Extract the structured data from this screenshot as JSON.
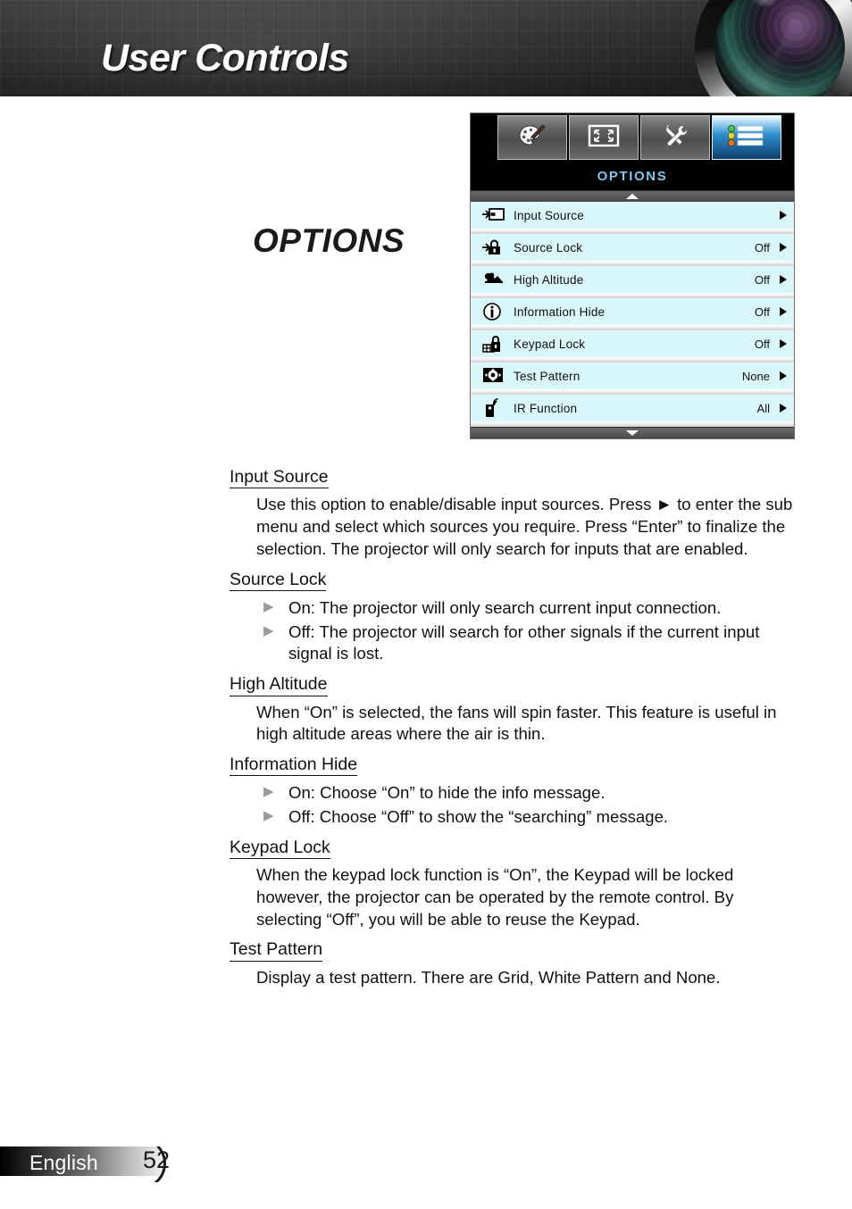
{
  "header": {
    "title": "User Controls",
    "lens_icon": "camera-lens-graphic"
  },
  "section_title": "OPTIONS",
  "osd": {
    "menu_title": "OPTIONS",
    "tabs": [
      {
        "name": "image-tab",
        "icon": "palette-icon",
        "active": false
      },
      {
        "name": "display-tab",
        "icon": "screen-icon",
        "active": false
      },
      {
        "name": "setup-tab",
        "icon": "tools-icon",
        "active": false
      },
      {
        "name": "options-tab",
        "icon": "list-icon",
        "active": true
      }
    ],
    "scroll_up_icon": "triangle-up-icon",
    "scroll_down_icon": "triangle-down-icon",
    "rows": [
      {
        "icon": "input-source-icon",
        "label": "Input Source",
        "value": ""
      },
      {
        "icon": "source-lock-icon",
        "label": "Source Lock",
        "value": "Off"
      },
      {
        "icon": "high-altitude-icon",
        "label": "High Altitude",
        "value": "Off"
      },
      {
        "icon": "information-hide-icon",
        "label": "Information Hide",
        "value": "Off"
      },
      {
        "icon": "keypad-lock-icon",
        "label": "Keypad Lock",
        "value": "Off"
      },
      {
        "icon": "test-pattern-icon",
        "label": "Test Pattern",
        "value": "None"
      },
      {
        "icon": "ir-function-icon",
        "label": "IR Function",
        "value": "All"
      }
    ]
  },
  "sections": [
    {
      "heading": "Input Source",
      "body": "Use this option to enable/disable input sources. Press ► to enter the sub menu and select which sources you require. Press “Enter” to finalize the selection. The projector will only search for inputs that are enabled.",
      "bullets": []
    },
    {
      "heading": "Source Lock",
      "body": "",
      "bullets": [
        "On: The projector will only search current input connection.",
        "Off: The projector will search for other signals if the current input signal is lost."
      ]
    },
    {
      "heading": "High Altitude",
      "body": "When “On” is selected, the fans will spin faster. This feature is useful in high altitude areas where the air is thin.",
      "bullets": []
    },
    {
      "heading": "Information Hide",
      "body": "",
      "bullets": [
        "On: Choose “On” to hide the info message.",
        "Off: Choose “Off” to show the “searching” message."
      ]
    },
    {
      "heading": "Keypad Lock",
      "body": "When the keypad lock function is “On”, the Keypad will be locked however, the projector can be operated by the remote control. By selecting “Off”, you will be able to reuse the Keypad.",
      "bullets": []
    },
    {
      "heading": "Test Pattern",
      "body": "Display a test pattern. There are Grid, White Pattern and None.",
      "bullets": []
    }
  ],
  "footer": {
    "language": "English",
    "page_number": "52"
  },
  "colors": {
    "osd_row_bg": "#d9f6fa",
    "osd_title_text": "#7fc6ef",
    "active_tab": "#2f91cf",
    "bullet_mark": "#9a9a9a"
  }
}
